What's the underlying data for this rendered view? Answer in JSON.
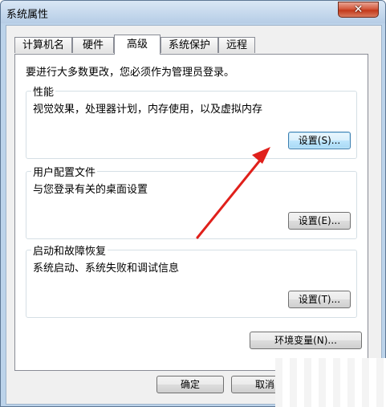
{
  "window": {
    "title": "系统属性"
  },
  "tabs": [
    {
      "label": "计算机名"
    },
    {
      "label": "硬件"
    },
    {
      "label": "高级"
    },
    {
      "label": "系统保护"
    },
    {
      "label": "远程"
    }
  ],
  "panel": {
    "admin_note": "要进行大多数更改，您必须作为管理员登录。",
    "performance": {
      "title": "性能",
      "description": "视觉效果，处理器计划，内存使用，以及虚拟内存",
      "button": "设置(S)..."
    },
    "user_profiles": {
      "title": "用户配置文件",
      "description": "与您登录有关的桌面设置",
      "button": "设置(E)..."
    },
    "startup_recovery": {
      "title": "启动和故障恢复",
      "description": "系统启动、系统失败和调试信息",
      "button": "设置(T)..."
    },
    "env_button": "环境变量(N)..."
  },
  "footer": {
    "ok": "确定",
    "cancel": "取消"
  },
  "colors": {
    "annotation_arrow": "#e0201b",
    "focus_border": "#3c7fb1"
  }
}
